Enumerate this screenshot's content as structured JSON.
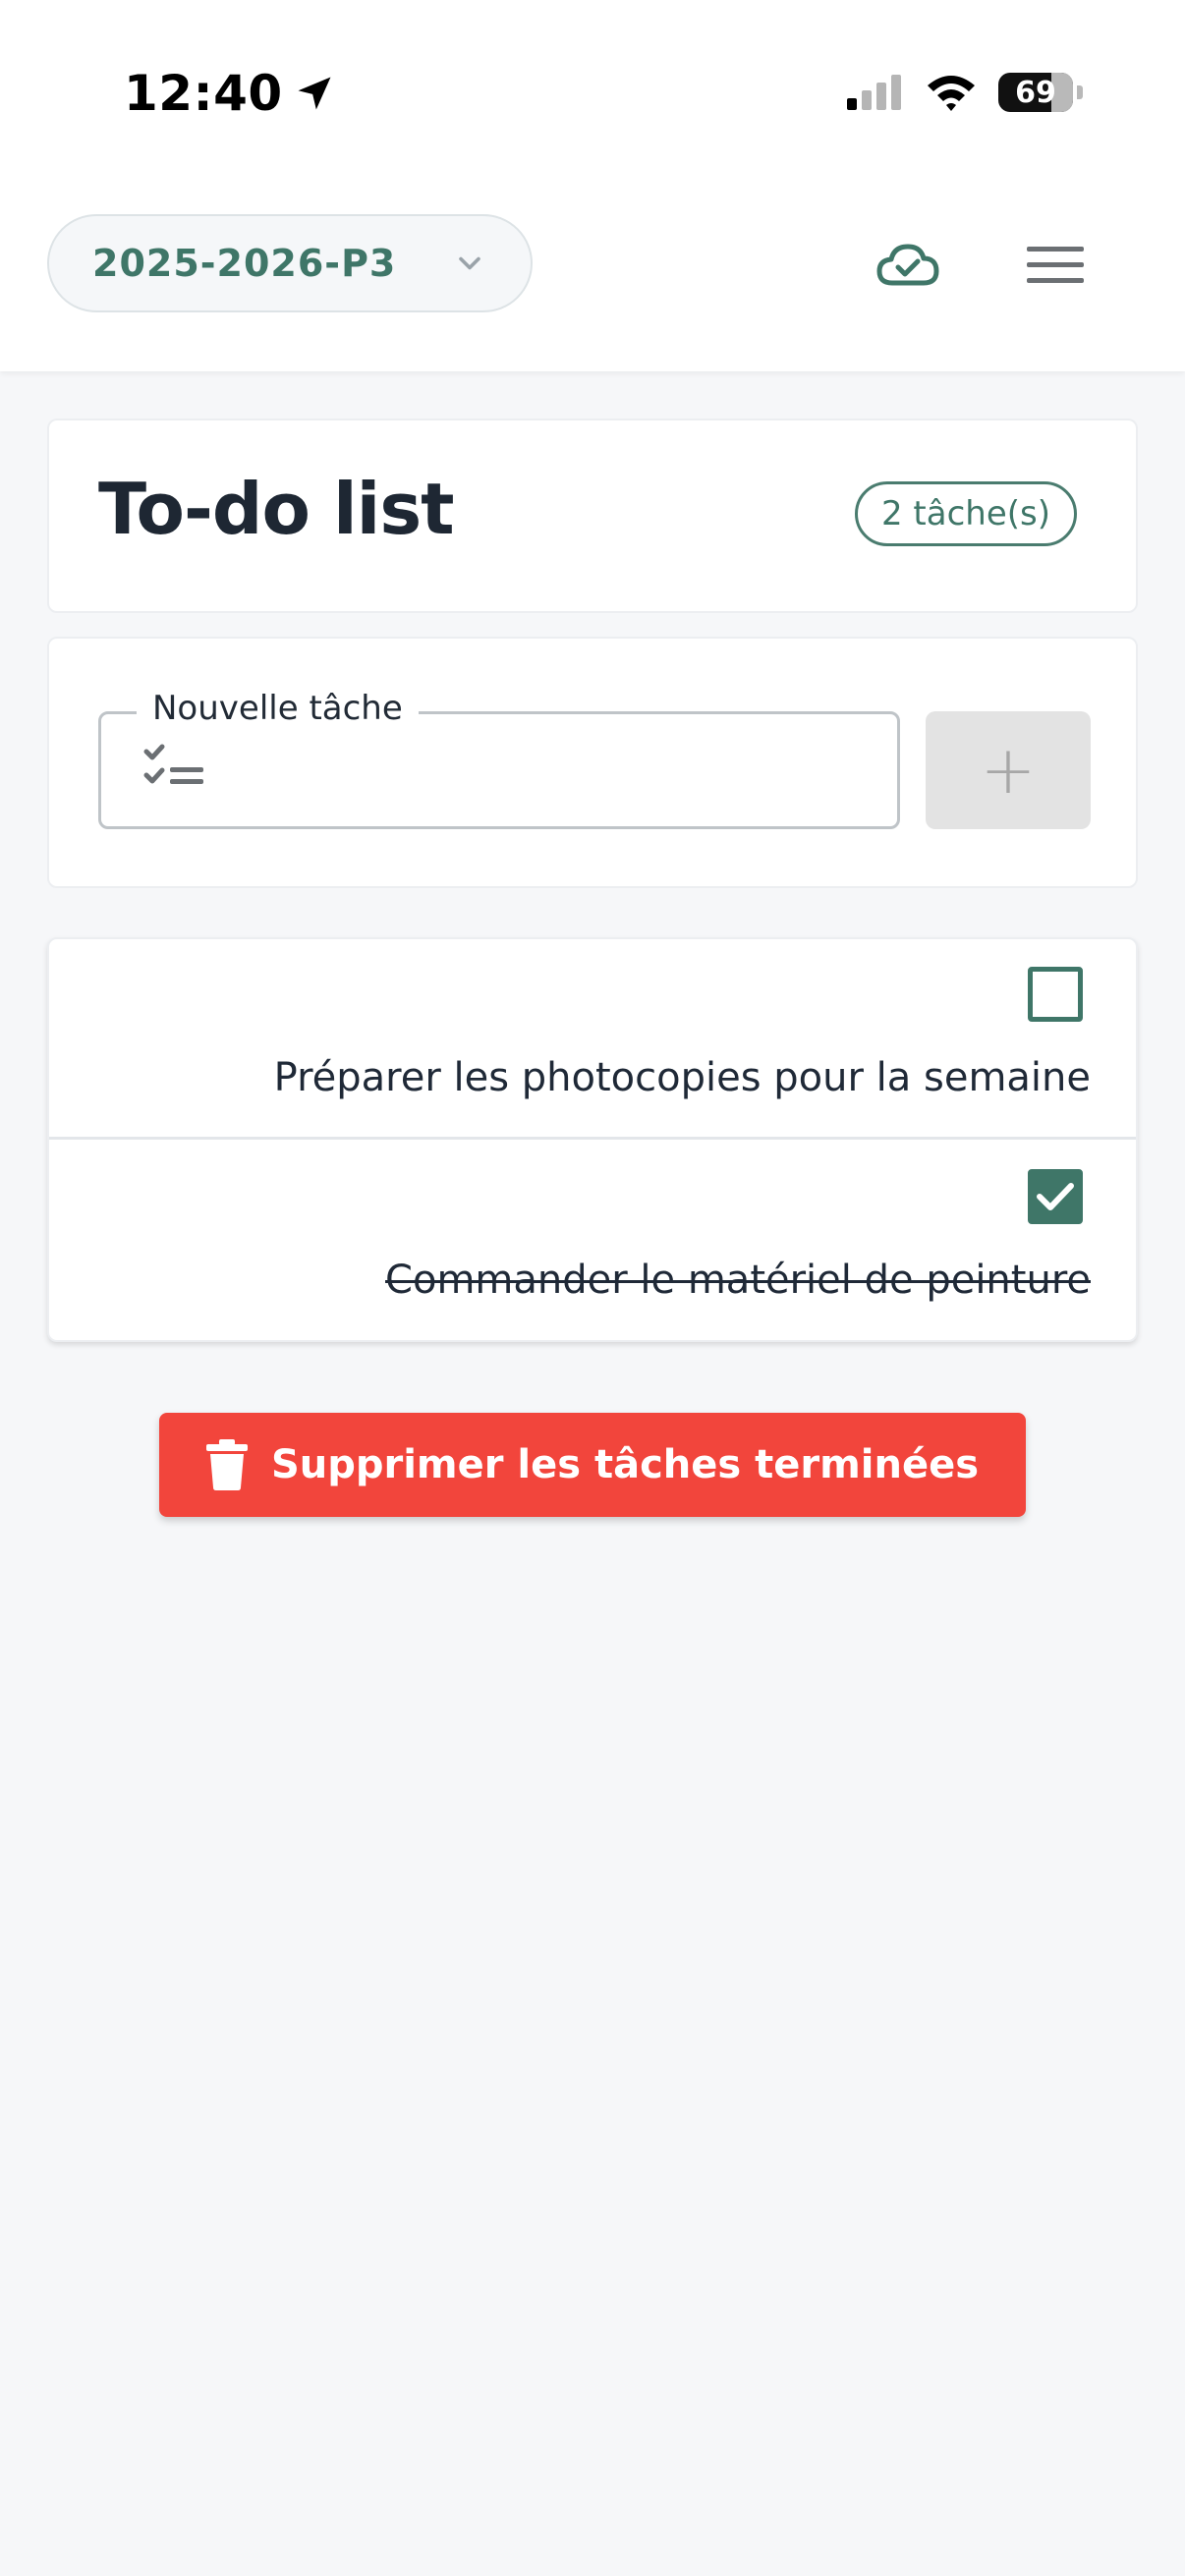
{
  "status_bar": {
    "time": "12:40",
    "battery": "69"
  },
  "header": {
    "year_selector": "2025-2026-P3"
  },
  "page": {
    "title": "To-do list",
    "task_count_badge": "2 tâche(s)"
  },
  "new_task": {
    "label": "Nouvelle tâche",
    "value": "",
    "add_button_label": "+"
  },
  "tasks": [
    {
      "text": "Préparer les photocopies pour la semaine",
      "done": false
    },
    {
      "text": "Commander le matériel de peinture",
      "done": true
    }
  ],
  "actions": {
    "delete_completed_label": "Supprimer les tâches terminées"
  },
  "colors": {
    "accent_green": "#3f7668",
    "danger_red": "#f2453c",
    "background": "#f6f7f9"
  },
  "icons": [
    "location-arrow-icon",
    "signal-icon",
    "wifi-icon",
    "battery-icon",
    "chevron-down-icon",
    "cloud-check-icon",
    "hamburger-menu-icon",
    "checklist-icon",
    "checkbox-icon",
    "trash-icon"
  ]
}
